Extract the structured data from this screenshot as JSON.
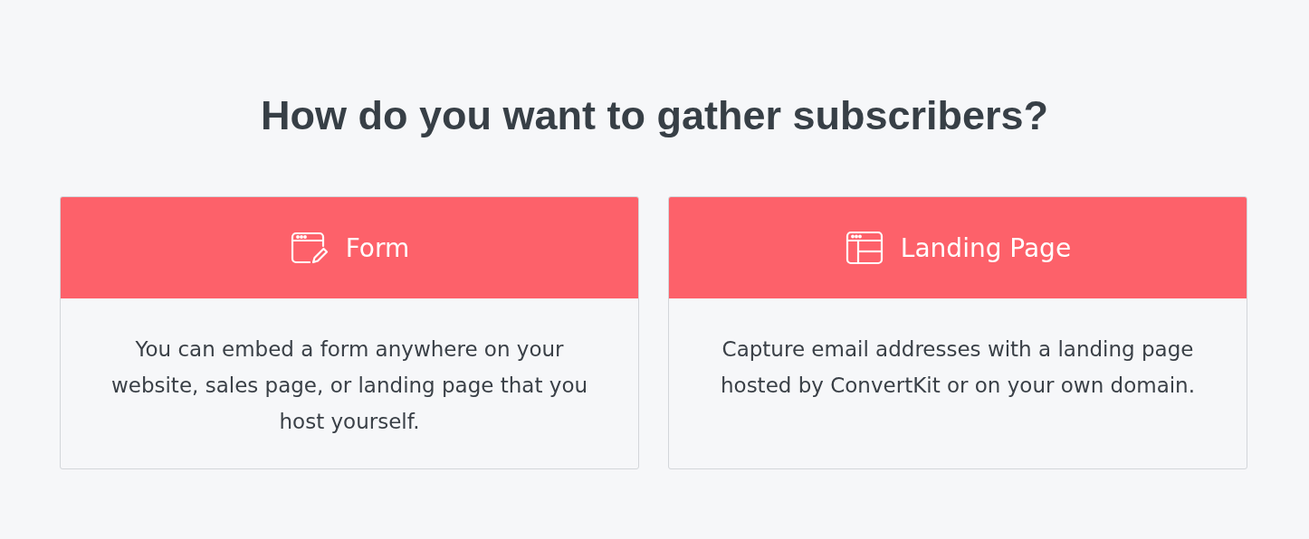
{
  "heading": "How do you want to gather subscribers?",
  "options": [
    {
      "kind": "form",
      "title": "Form",
      "description": "You can embed a form anywhere on your website, sales page, or landing page that you host yourself."
    },
    {
      "kind": "landing",
      "title": "Landing Page",
      "description": "Capture email addresses with a landing page hosted by ConvertKit or on your own domain."
    }
  ]
}
